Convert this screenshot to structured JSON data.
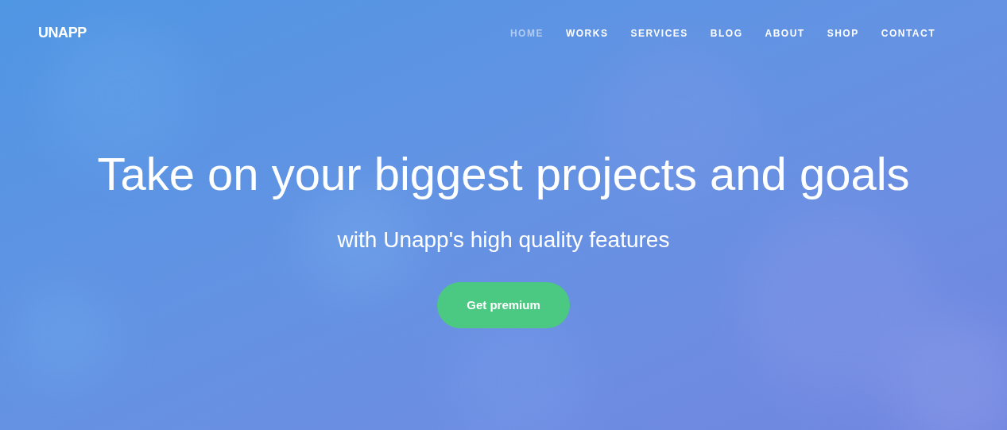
{
  "logo": "UNAPP",
  "nav": [
    {
      "label": "HOME",
      "selected": true
    },
    {
      "label": "WORKS",
      "selected": false
    },
    {
      "label": "SERVICES",
      "selected": false
    },
    {
      "label": "BLOG",
      "selected": false
    },
    {
      "label": "ABOUT",
      "selected": false
    },
    {
      "label": "SHOP",
      "selected": false
    },
    {
      "label": "CONTACT",
      "selected": false
    }
  ],
  "hero": {
    "title": "Take on your biggest projects and goals",
    "subtitle": "with Unapp's high quality features",
    "button": "Get premium"
  }
}
